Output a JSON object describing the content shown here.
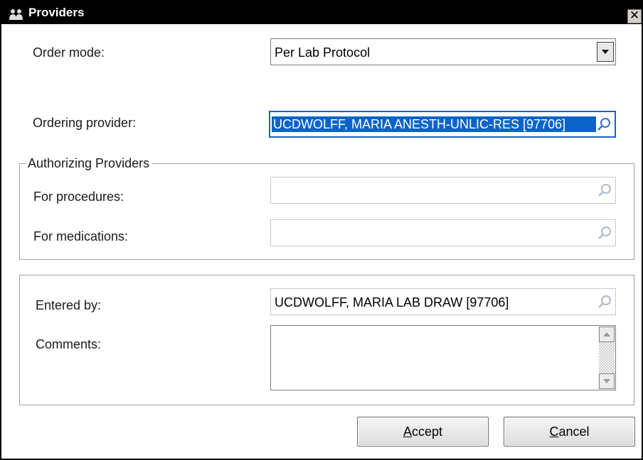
{
  "window": {
    "title": "Providers",
    "close_glyph": "✕"
  },
  "order_mode": {
    "label": "Order mode:",
    "value": "Per Lab Protocol"
  },
  "ordering_provider": {
    "label": "Ordering provider:",
    "value": "UCDWOLFF, MARIA ANESTH-UNLIC-RES [97706]"
  },
  "authorizing": {
    "legend": "Authorizing Providers",
    "procedures_label": "For procedures:",
    "procedures_value": "",
    "medications_label": "For medications:",
    "medications_value": ""
  },
  "entered_by": {
    "label": "Entered by:",
    "value": "UCDWOLFF, MARIA LAB DRAW [97706]"
  },
  "comments": {
    "label": "Comments:",
    "value": ""
  },
  "buttons": {
    "accept_mnemonic": "A",
    "accept_rest": "ccept",
    "cancel_mnemonic": "C",
    "cancel_rest": "ancel"
  },
  "icons": {
    "title": "users-icon",
    "lookup": "magnifier-icon",
    "dropdown": "chevron-down-icon"
  },
  "colors": {
    "titlebar": "#000000",
    "selection": "#0a64c8",
    "accent": "#2060c0"
  }
}
